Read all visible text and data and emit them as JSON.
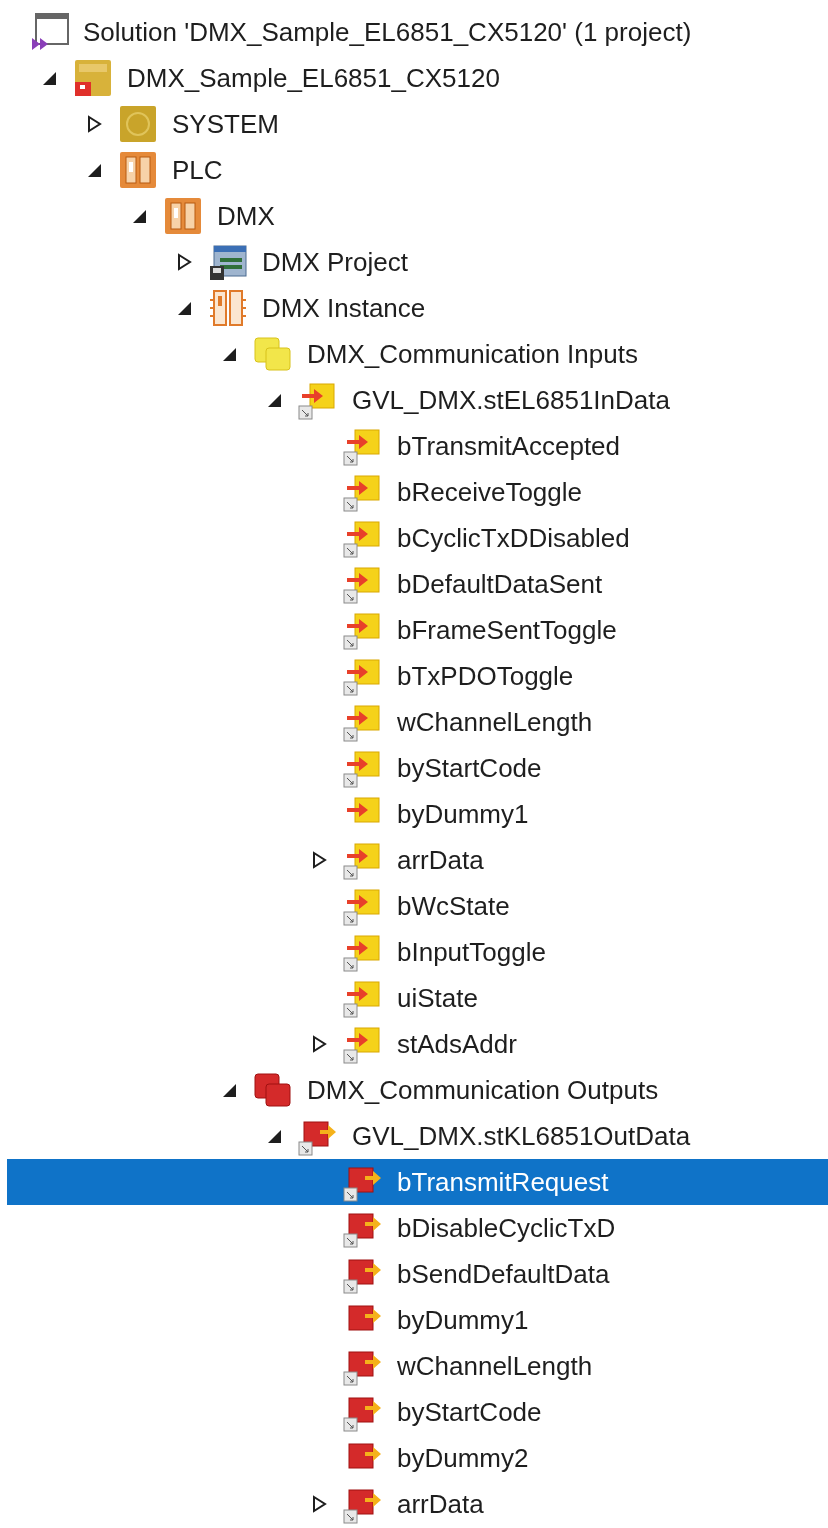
{
  "solution": {
    "label": "Solution 'DMX_Sample_EL6851_CX5120' (1 project)",
    "selected": false
  },
  "tree": [
    {
      "label": "DMX_Sample_EL6851_CX5120",
      "kind": "project",
      "expanded": true,
      "selected": false,
      "children": [
        {
          "label": "SYSTEM",
          "kind": "system",
          "expanded": false,
          "selected": false
        },
        {
          "label": "PLC",
          "kind": "plc",
          "expanded": true,
          "selected": false,
          "children": [
            {
              "label": "DMX",
              "kind": "plc",
              "expanded": true,
              "selected": false,
              "children": [
                {
                  "label": "DMX Project",
                  "kind": "plc-project",
                  "expanded": false,
                  "selected": false
                },
                {
                  "label": "DMX Instance",
                  "kind": "instance",
                  "expanded": true,
                  "selected": false,
                  "children": [
                    {
                      "label": "DMX_Communication Inputs",
                      "kind": "input-folder",
                      "expanded": true,
                      "selected": false,
                      "children": [
                        {
                          "label": "GVL_DMX.stEL6851InData",
                          "kind": "input-var",
                          "linked": true,
                          "expanded": true,
                          "selected": false,
                          "children": [
                            {
                              "label": "bTransmitAccepted",
                              "kind": "input-var",
                              "linked": true,
                              "selected": false
                            },
                            {
                              "label": "bReceiveToggle",
                              "kind": "input-var",
                              "linked": true,
                              "selected": false
                            },
                            {
                              "label": "bCyclicTxDDisabled",
                              "kind": "input-var",
                              "linked": true,
                              "selected": false
                            },
                            {
                              "label": "bDefaultDataSent",
                              "kind": "input-var",
                              "linked": true,
                              "selected": false
                            },
                            {
                              "label": "bFrameSentToggle",
                              "kind": "input-var",
                              "linked": true,
                              "selected": false
                            },
                            {
                              "label": "bTxPDOToggle",
                              "kind": "input-var",
                              "linked": true,
                              "selected": false
                            },
                            {
                              "label": "wChannelLength",
                              "kind": "input-var",
                              "linked": true,
                              "selected": false
                            },
                            {
                              "label": "byStartCode",
                              "kind": "input-var",
                              "linked": true,
                              "selected": false
                            },
                            {
                              "label": "byDummy1",
                              "kind": "input-var",
                              "linked": false,
                              "selected": false
                            },
                            {
                              "label": "arrData",
                              "kind": "input-var",
                              "linked": true,
                              "expanded": false,
                              "selected": false
                            },
                            {
                              "label": "bWcState",
                              "kind": "input-var",
                              "linked": true,
                              "selected": false
                            },
                            {
                              "label": "bInputToggle",
                              "kind": "input-var",
                              "linked": true,
                              "selected": false
                            },
                            {
                              "label": "uiState",
                              "kind": "input-var",
                              "linked": true,
                              "selected": false
                            },
                            {
                              "label": "stAdsAddr",
                              "kind": "input-var",
                              "linked": true,
                              "expanded": false,
                              "selected": false
                            }
                          ]
                        }
                      ]
                    },
                    {
                      "label": "DMX_Communication Outputs",
                      "kind": "output-folder",
                      "expanded": true,
                      "selected": false,
                      "children": [
                        {
                          "label": "GVL_DMX.stKL6851OutData",
                          "kind": "output-var",
                          "linked": true,
                          "expanded": true,
                          "selected": false,
                          "children": [
                            {
                              "label": "bTransmitRequest",
                              "kind": "output-var",
                              "linked": true,
                              "selected": true
                            },
                            {
                              "label": "bDisableCyclicTxD",
                              "kind": "output-var",
                              "linked": true,
                              "selected": false
                            },
                            {
                              "label": "bSendDefaultData",
                              "kind": "output-var",
                              "linked": true,
                              "selected": false
                            },
                            {
                              "label": "byDummy1",
                              "kind": "output-var",
                              "linked": false,
                              "selected": false
                            },
                            {
                              "label": "wChannelLength",
                              "kind": "output-var",
                              "linked": true,
                              "selected": false
                            },
                            {
                              "label": "byStartCode",
                              "kind": "output-var",
                              "linked": true,
                              "selected": false
                            },
                            {
                              "label": "byDummy2",
                              "kind": "output-var",
                              "linked": false,
                              "selected": false
                            },
                            {
                              "label": "arrData",
                              "kind": "output-var",
                              "linked": true,
                              "expanded": false,
                              "selected": false
                            }
                          ]
                        }
                      ]
                    }
                  ]
                }
              ]
            }
          ]
        }
      ]
    }
  ]
}
